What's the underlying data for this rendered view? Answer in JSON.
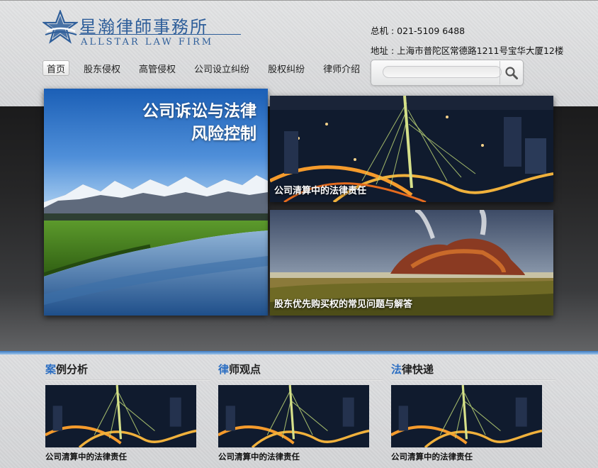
{
  "brand": {
    "name_cn": "星瀚律師事務所",
    "name_en": "ALLSTAR LAW FIRM",
    "accent_color": "#2e5e9a"
  },
  "contact": {
    "phone": "总机 : 021-5109 6488",
    "address": "地址 : 上海市普陀区常德路1211号宝华大厦12楼"
  },
  "nav": {
    "items": [
      {
        "label": "首页",
        "active": true
      },
      {
        "label": "股东侵权",
        "active": false
      },
      {
        "label": "高管侵权",
        "active": false
      },
      {
        "label": "公司设立纠纷",
        "active": false
      },
      {
        "label": "股权纠纷",
        "active": false
      },
      {
        "label": "律师介绍",
        "active": false
      }
    ]
  },
  "search": {
    "placeholder": "",
    "icon": "search-icon"
  },
  "hero": {
    "main": {
      "title_line1": "公司诉讼与法律",
      "title_line2": "风险控制",
      "image": "mountain-lake-photo"
    },
    "cards": [
      {
        "caption": "公司清算中的法律责任",
        "image": "night-bridge-photo"
      },
      {
        "caption": "股东优先购买权的常见问题与解答",
        "image": "geyser-landscape-photo"
      }
    ]
  },
  "sections": [
    {
      "accent": "案",
      "rest": "例分析",
      "caption": "公司清算中的法律责任",
      "image": "night-bridge-photo"
    },
    {
      "accent": "律",
      "rest": "师观点",
      "caption": "公司清算中的法律责任",
      "image": "night-bridge-photo"
    },
    {
      "accent": "法",
      "rest": "律快递",
      "caption": "公司清算中的法律责任",
      "image": "night-bridge-photo"
    }
  ],
  "colors": {
    "section_accent": "#2b6ec2",
    "dark_band": "#262627",
    "blue_line": "#3c7cc4"
  }
}
